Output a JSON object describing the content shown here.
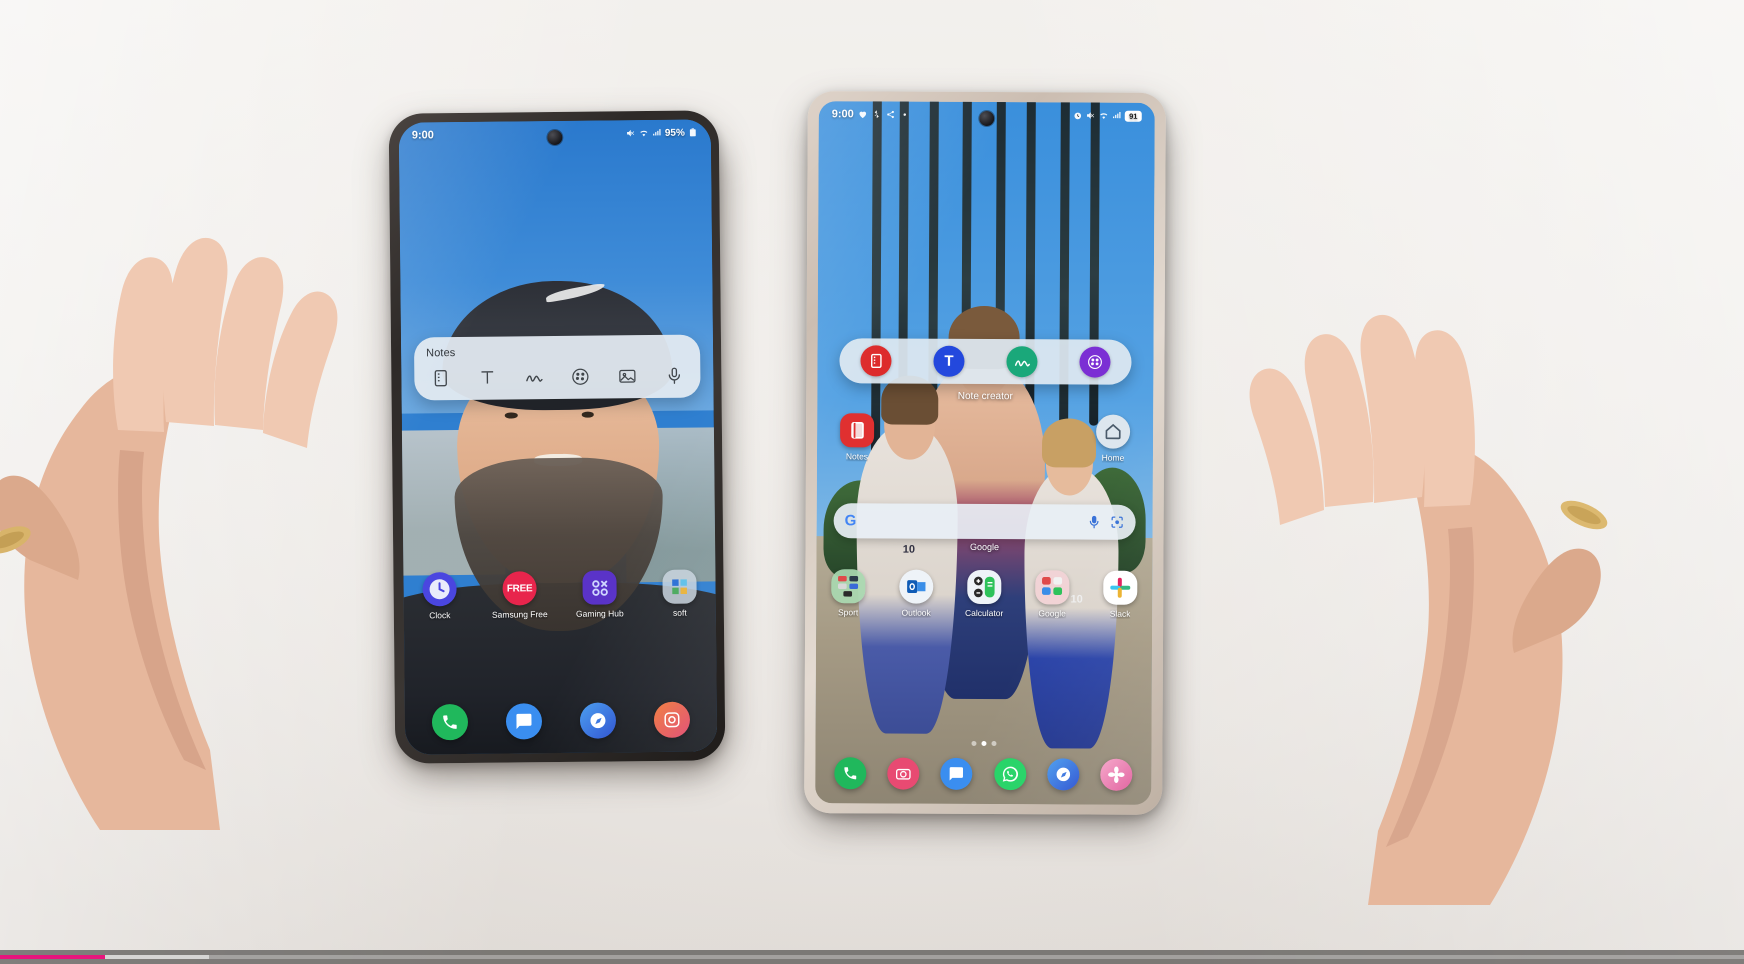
{
  "scene": {
    "description": "Two Samsung smartphones side by side on a white desk with two hands gesturing",
    "surface_color": "#e9e5e1"
  },
  "video_player": {
    "progress_percent": 6,
    "buffered_percent": 12,
    "accent_color": "#e8157d"
  },
  "left_phone": {
    "device_frame_color": "#2e2a28",
    "status_bar": {
      "time": "9:00",
      "icons": [
        "mute-icon",
        "wifi-icon",
        "signal-icon"
      ],
      "battery_text": "95%"
    },
    "wallpaper": "selfie photo of bearded man wearing a dark cap outdoors",
    "notes_widget": {
      "title": "Notes",
      "tools": [
        {
          "name": "note-tool",
          "icon": "notepad-icon"
        },
        {
          "name": "text-tool",
          "icon": "text-t-icon"
        },
        {
          "name": "handwriting-tool",
          "icon": "handwriting-icon"
        },
        {
          "name": "palette-tool",
          "icon": "palette-icon"
        },
        {
          "name": "image-tool",
          "icon": "image-icon"
        },
        {
          "name": "voice-tool",
          "icon": "microphone-icon"
        }
      ]
    },
    "app_row": [
      {
        "label": "Clock",
        "icon": "clock-icon",
        "color": "#4a46e0"
      },
      {
        "label": "Samsung Free",
        "icon": "free-icon",
        "color": "#e8254c"
      },
      {
        "label": "Gaming Hub",
        "icon": "gaming-hub-icon",
        "color": "#5a33c8"
      },
      {
        "label": "soft",
        "icon": "microsoft-folder-icon",
        "color": "#b9c6cf"
      }
    ],
    "dock": [
      {
        "name": "phone",
        "icon": "phone-icon",
        "color": "#20b85c"
      },
      {
        "name": "messages",
        "icon": "messages-icon",
        "color": "#3a8ef0"
      },
      {
        "name": "browser",
        "icon": "samsung-internet-icon",
        "color": "#2f6fe0"
      },
      {
        "name": "gallery",
        "icon": "gallery-icon",
        "color": "#e0466e"
      }
    ]
  },
  "right_phone": {
    "device_frame_color": "#ded3c9",
    "status_bar": {
      "time": "9:00",
      "left_icons": [
        "heart-icon",
        "bluetooth-icon",
        "share-icon",
        "dot-icon"
      ],
      "right_icons": [
        "alarm-icon",
        "mute-icon",
        "wifi-icon",
        "signal-icon"
      ],
      "battery_text": "91"
    },
    "wallpaper": "family photo with palm trees, woman and three children in football kits",
    "note_creator_widget": {
      "label": "Note creator",
      "tools": [
        {
          "name": "note-tool",
          "icon": "notepad-icon",
          "color": "#dd2b2b"
        },
        {
          "name": "text-tool",
          "icon": "text-t-icon",
          "color": "#2348dd"
        },
        {
          "name": "handwriting-tool",
          "icon": "handwriting-icon",
          "color": "#1aa87a"
        },
        {
          "name": "palette-tool",
          "icon": "palette-icon",
          "color": "#7b2fd4"
        }
      ]
    },
    "top_apps": [
      {
        "label": "Notes",
        "icon": "notes-icon",
        "color": "#e03030"
      },
      {
        "label": "Home",
        "icon": "home-icon",
        "color": "#cfd9e2"
      }
    ],
    "search_bar": {
      "logo": "G",
      "placeholder": "",
      "mic_icon": "microphone-icon",
      "lens_icon": "google-lens-icon",
      "label": "Google"
    },
    "app_row": [
      {
        "label": "Sport",
        "icon": "sport-folder-icon",
        "color": "#a8d8b0"
      },
      {
        "label": "Outlook",
        "icon": "outlook-icon",
        "color": "#e8eef5"
      },
      {
        "label": "Calculator",
        "icon": "calculator-icon",
        "color": "#e8eef5"
      },
      {
        "label": "Google",
        "icon": "google-folder-icon",
        "color": "#f0d4d8"
      },
      {
        "label": "Slack",
        "icon": "slack-icon",
        "color": "#ffffff"
      }
    ],
    "page_indicator": {
      "pages": 3,
      "active": 1
    },
    "dock": [
      {
        "name": "phone",
        "icon": "phone-icon",
        "color": "#20b85c"
      },
      {
        "name": "camera",
        "icon": "camera-icon",
        "color": "#e84a72"
      },
      {
        "name": "messages",
        "icon": "messages-icon",
        "color": "#3a8ef0"
      },
      {
        "name": "whatsapp",
        "icon": "whatsapp-icon",
        "color": "#25d366"
      },
      {
        "name": "browser",
        "icon": "samsung-internet-icon",
        "color": "#2f6fe0"
      },
      {
        "name": "gallery",
        "icon": "gallery-icon",
        "color": "#f06292"
      }
    ]
  }
}
